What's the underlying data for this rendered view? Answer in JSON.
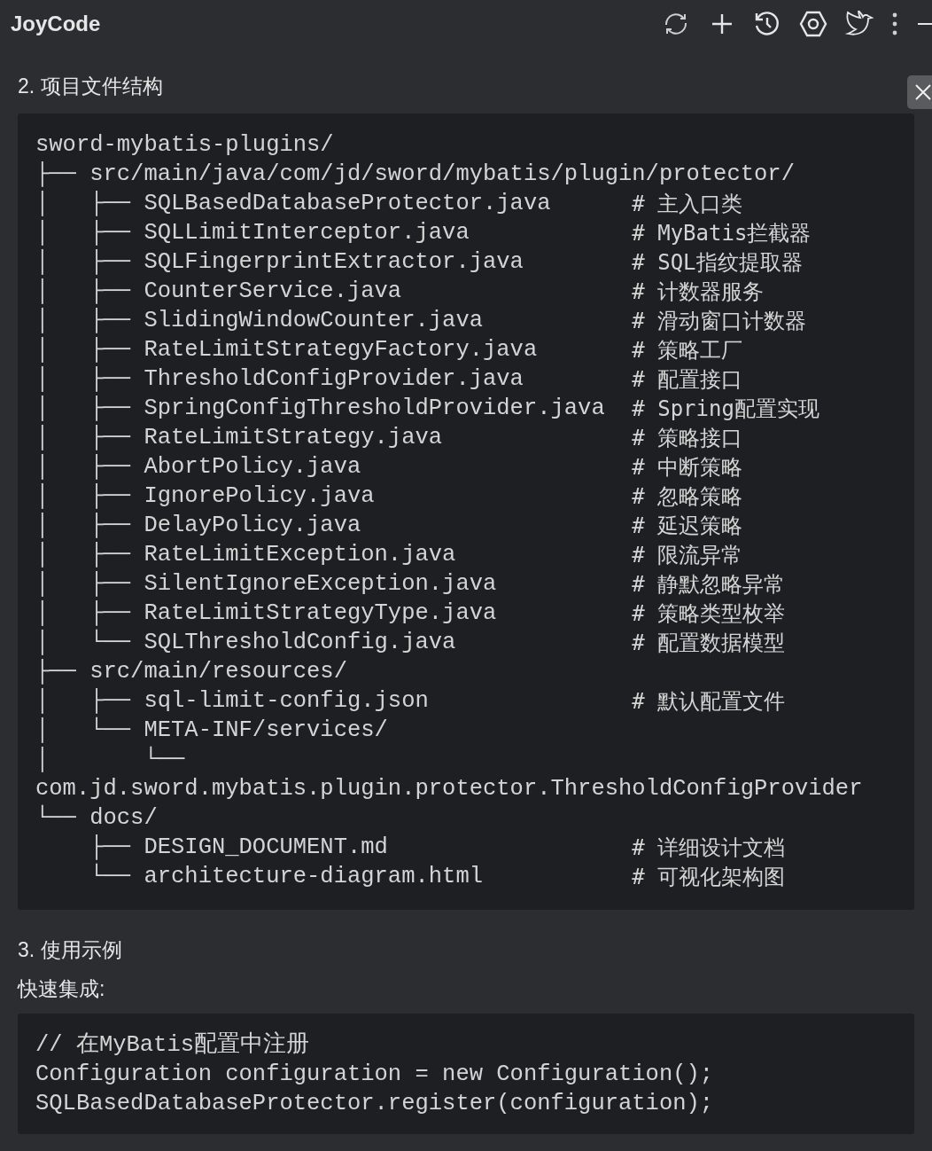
{
  "header": {
    "title": "JoyCode"
  },
  "sections": [
    {
      "heading": "2. 项目文件结构",
      "blocks": [
        {
          "kind": "tree",
          "lines": [
            {
              "text": "sword-mybatis-plugins/"
            },
            {
              "text": "├── src/main/java/com/jd/sword/mybatis/plugin/protector/"
            },
            {
              "text": "│   ├── SQLBasedDatabaseProtector.java",
              "comment": "# 主入口类"
            },
            {
              "text": "│   ├── SQLLimitInterceptor.java",
              "comment": "# MyBatis拦截器"
            },
            {
              "text": "│   ├── SQLFingerprintExtractor.java",
              "comment": "# SQL指纹提取器"
            },
            {
              "text": "│   ├── CounterService.java",
              "comment": "# 计数器服务"
            },
            {
              "text": "│   ├── SlidingWindowCounter.java",
              "comment": "# 滑动窗口计数器"
            },
            {
              "text": "│   ├── RateLimitStrategyFactory.java",
              "comment": "# 策略工厂"
            },
            {
              "text": "│   ├── ThresholdConfigProvider.java",
              "comment": "# 配置接口"
            },
            {
              "text": "│   ├── SpringConfigThresholdProvider.java",
              "comment": "# Spring配置实现"
            },
            {
              "text": "│   ├── RateLimitStrategy.java",
              "comment": "# 策略接口"
            },
            {
              "text": "│   ├── AbortPolicy.java",
              "comment": "# 中断策略"
            },
            {
              "text": "│   ├── IgnorePolicy.java",
              "comment": "# 忽略策略"
            },
            {
              "text": "│   ├── DelayPolicy.java",
              "comment": "# 延迟策略"
            },
            {
              "text": "│   ├── RateLimitException.java",
              "comment": "# 限流异常"
            },
            {
              "text": "│   ├── SilentIgnoreException.java",
              "comment": "# 静默忽略异常"
            },
            {
              "text": "│   ├── RateLimitStrategyType.java",
              "comment": "# 策略类型枚举"
            },
            {
              "text": "│   └── SQLThresholdConfig.java",
              "comment": "# 配置数据模型"
            },
            {
              "text": "├── src/main/resources/"
            },
            {
              "text": "│   ├── sql-limit-config.json",
              "comment": "# 默认配置文件"
            },
            {
              "text": "│   └── META-INF/services/"
            },
            {
              "text": "│       └──"
            },
            {
              "text": "com.jd.sword.mybatis.plugin.protector.ThresholdConfigProvider"
            },
            {
              "text": "└── docs/"
            },
            {
              "text": "    ├── DESIGN_DOCUMENT.md",
              "comment": "# 详细设计文档"
            },
            {
              "text": "    └── architecture-diagram.html",
              "comment": "# 可视化架构图"
            }
          ]
        }
      ]
    },
    {
      "heading": "3. 使用示例",
      "blocks": [
        {
          "kind": "label",
          "text": "快速集成:"
        },
        {
          "kind": "code",
          "lines": [
            {
              "text": "// 在MyBatis配置中注册"
            },
            {
              "text": "Configuration configuration = new Configuration();"
            },
            {
              "text": "SQLBasedDatabaseProtector.register(configuration);"
            }
          ]
        }
      ]
    }
  ]
}
